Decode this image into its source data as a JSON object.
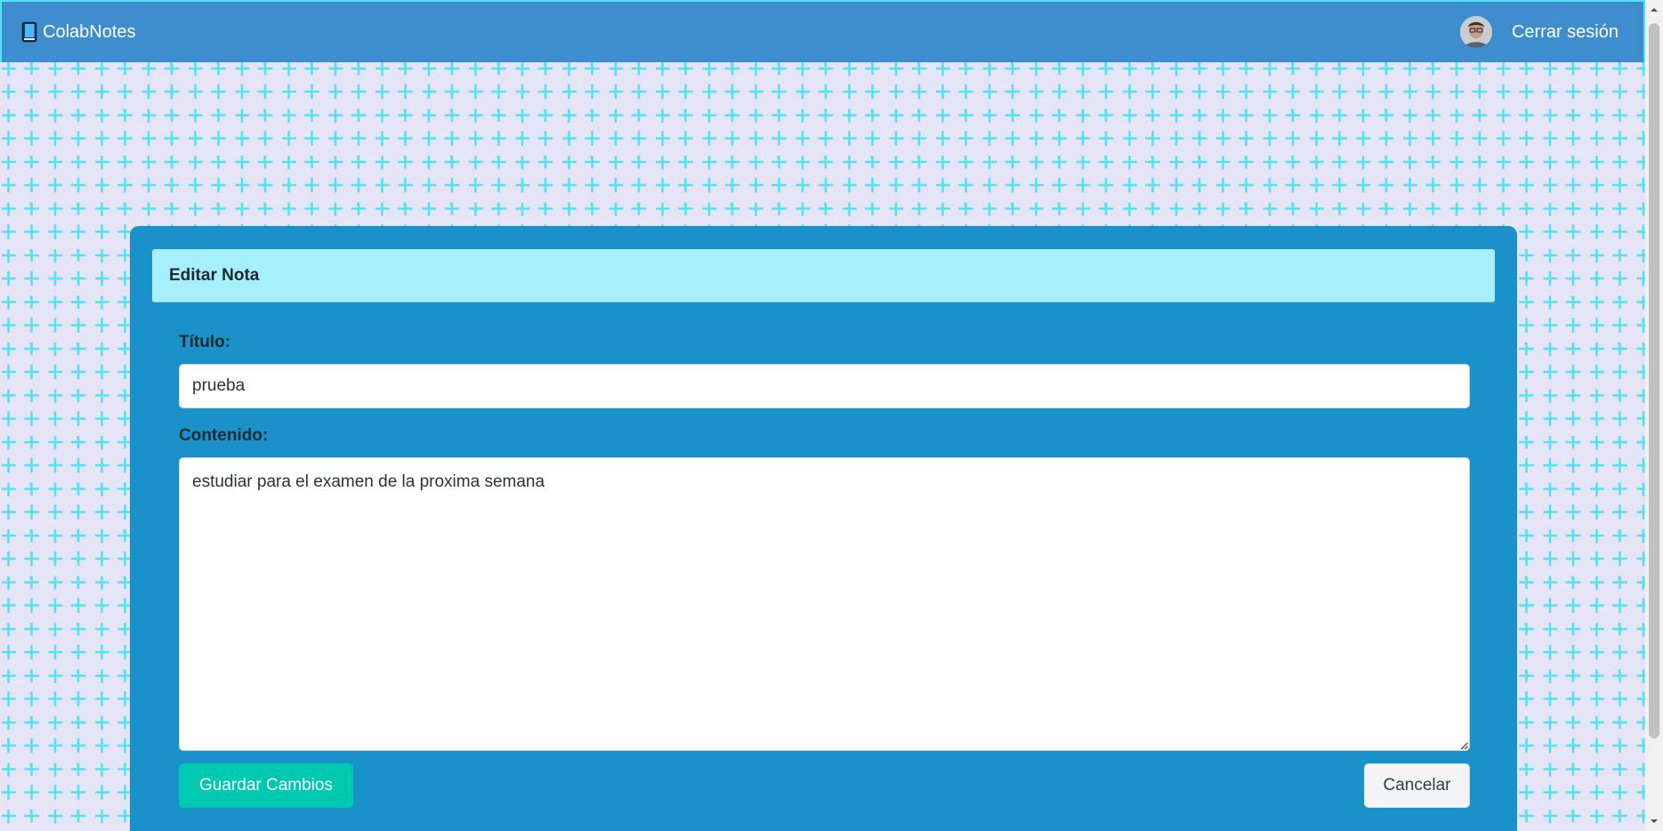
{
  "navbar": {
    "brand_icon": "book-icon",
    "brand_label": "ColabNotes",
    "avatar_icon": "user-avatar",
    "logout_label": "Cerrar sesión",
    "background_color": "#3e8ecf"
  },
  "page": {
    "background_color": "#e5e5f7",
    "pattern_color": "#55e1f5",
    "pattern_icon": "plus-icon"
  },
  "form": {
    "header_title": "Editar Nota",
    "title_label": "Título:",
    "title_value": "prueba",
    "content_label": "Contenido:",
    "content_value": "estudiar para el examen de la proxima semana",
    "save_label": "Guardar Cambios",
    "cancel_label": "Cancelar",
    "card_color": "#1b91c9",
    "header_color": "#a6f0fb",
    "save_color": "#00c9b1"
  }
}
